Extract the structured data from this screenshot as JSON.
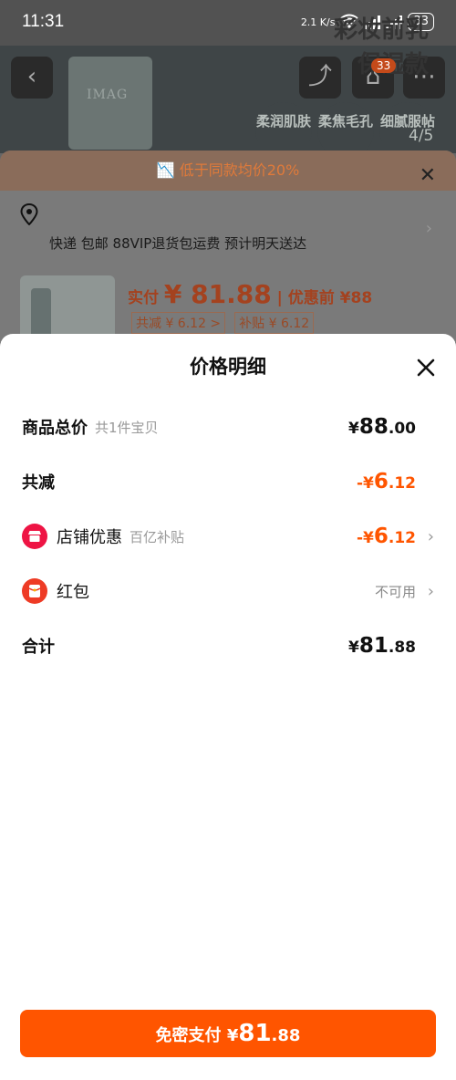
{
  "status_bar": {
    "time": "11:31",
    "net_speed": "2.1 K/s",
    "battery": "33"
  },
  "background": {
    "brand_text": "IMAG",
    "promo_line1": "彩妆前乳",
    "promo_line2": "保湿款",
    "cart_count": "33",
    "features": [
      "柔润肌肤",
      "柔焦毛孔",
      "细腻服帖"
    ],
    "feature_count": "4/5"
  },
  "order_sheet": {
    "banner": "低于同款均价20%",
    "shipping": "快递 包邮 88VIP退货包运费 预计明天送达",
    "pay_label": "实付",
    "pay_price": "¥ 81.88",
    "pre_discount": "| 优惠前 ¥88",
    "chip_reduce": "共减 ¥ 6.12 >",
    "chip_subsidy": "补贴 ¥ 6.12"
  },
  "price_detail": {
    "title": "价格明细",
    "rows": {
      "total": {
        "label": "商品总价",
        "sub": "共1件宝贝",
        "yen": "¥",
        "int": "88",
        "dec": ".00"
      },
      "reduced": {
        "label": "共减",
        "yen": "-¥",
        "int": "6",
        "dec": ".12"
      },
      "shop": {
        "label": "店铺优惠",
        "sub": "百亿补贴",
        "yen": "-¥",
        "int": "6",
        "dec": ".12"
      },
      "redpacket": {
        "label": "红包",
        "value": "不可用"
      },
      "sum": {
        "label": "合计",
        "yen": "¥",
        "int": "81",
        "dec": ".88"
      }
    },
    "pay_button": {
      "label": "免密支付",
      "yen": "¥",
      "int": "81",
      "dec": ".88"
    }
  },
  "colors": {
    "accent": "#ff5500",
    "shop_icon": "#ee1444",
    "redpacket_icon": "#ee3b25"
  }
}
